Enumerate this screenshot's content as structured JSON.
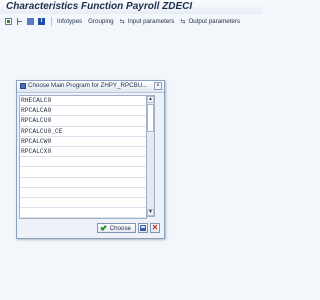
{
  "window": {
    "title": "Characteristics Function Payroll ZDECI"
  },
  "toolbar": {
    "items": [
      {
        "label": "Infotypes"
      },
      {
        "label": "Grouping"
      },
      {
        "label": "Input parameters"
      },
      {
        "label": "Output parameters"
      }
    ]
  },
  "dialog": {
    "title": "Choose Main Program for ZHPY_RPCBU...",
    "list": [
      "RHECALC0",
      "RPCALCA0",
      "RPCALCU0",
      "RPCALCU0_CE",
      "RPCALCW0",
      "RPCALCX0",
      "",
      "",
      "",
      "",
      "",
      ""
    ],
    "choose_label": "Choose"
  },
  "colors": {
    "accent": "#1f4fa3",
    "background": "#f3f6fa",
    "cancel": "#c0271f",
    "ok": "#2b8a2b"
  }
}
